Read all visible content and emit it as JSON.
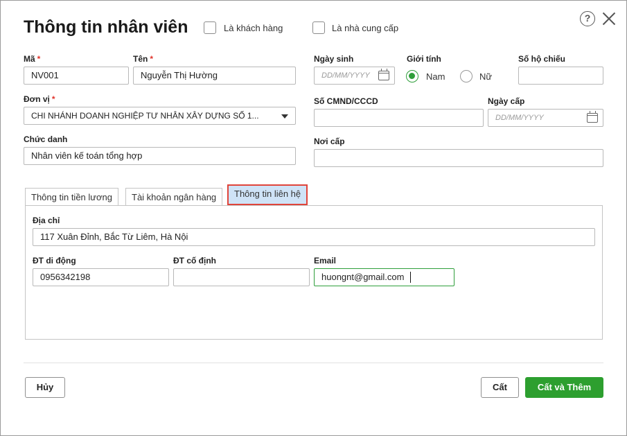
{
  "dialog": {
    "title": "Thông tin nhân viên",
    "checkbox_customer": "Là khách hàng",
    "checkbox_supplier": "Là nhà cung cấp",
    "help_glyph": "?"
  },
  "fields": {
    "ma": {
      "label": "Mã",
      "required": "*",
      "value": "NV001"
    },
    "ten": {
      "label": "Tên",
      "required": "*",
      "value": "Nguyễn Thị Hường"
    },
    "ngay_sinh": {
      "label": "Ngày sinh",
      "placeholder": "DD/MM/YYYY"
    },
    "gioi_tinh": {
      "label": "Giới tính",
      "option_male": "Nam",
      "option_female": "Nữ",
      "selected": "Nam"
    },
    "so_ho_chieu": {
      "label": "Số hộ chiếu",
      "value": ""
    },
    "don_vi": {
      "label": "Đơn vị",
      "required": "*",
      "value": "CHI NHÁNH DOANH NGHIỆP TƯ NHÂN XÂY DỰNG SỐ 1..."
    },
    "so_cmnd": {
      "label": "Số CMND/CCCD",
      "value": ""
    },
    "ngay_cap": {
      "label": "Ngày cấp",
      "placeholder": "DD/MM/YYYY"
    },
    "chuc_danh": {
      "label": "Chức danh",
      "value": "Nhân viên kế toán tổng hợp"
    },
    "noi_cap": {
      "label": "Nơi cấp",
      "value": ""
    }
  },
  "tabs": [
    {
      "label": "Thông tin tiền lương",
      "active": false
    },
    {
      "label": "Tài khoản ngân hàng",
      "active": false
    },
    {
      "label": "Thông tin liên hệ",
      "active": true
    }
  ],
  "contact": {
    "dia_chi": {
      "label": "Địa chỉ",
      "value": "117 Xuân Đỉnh, Bắc Từ Liêm, Hà Nội"
    },
    "dt_di_dong": {
      "label": "ĐT di động",
      "value": "0956342198"
    },
    "dt_co_dinh": {
      "label": "ĐT cố định",
      "value": ""
    },
    "email": {
      "label": "Email",
      "value": "huongnt@gmail.com"
    }
  },
  "buttons": {
    "cancel": "Hủy",
    "save": "Cất",
    "save_and_add": "Cất và Thêm"
  },
  "colors": {
    "primary": "#2d9f2f",
    "required": "#e0342b",
    "highlight_border": "#e0443a",
    "active_tab_bg": "#cfe3f7"
  }
}
